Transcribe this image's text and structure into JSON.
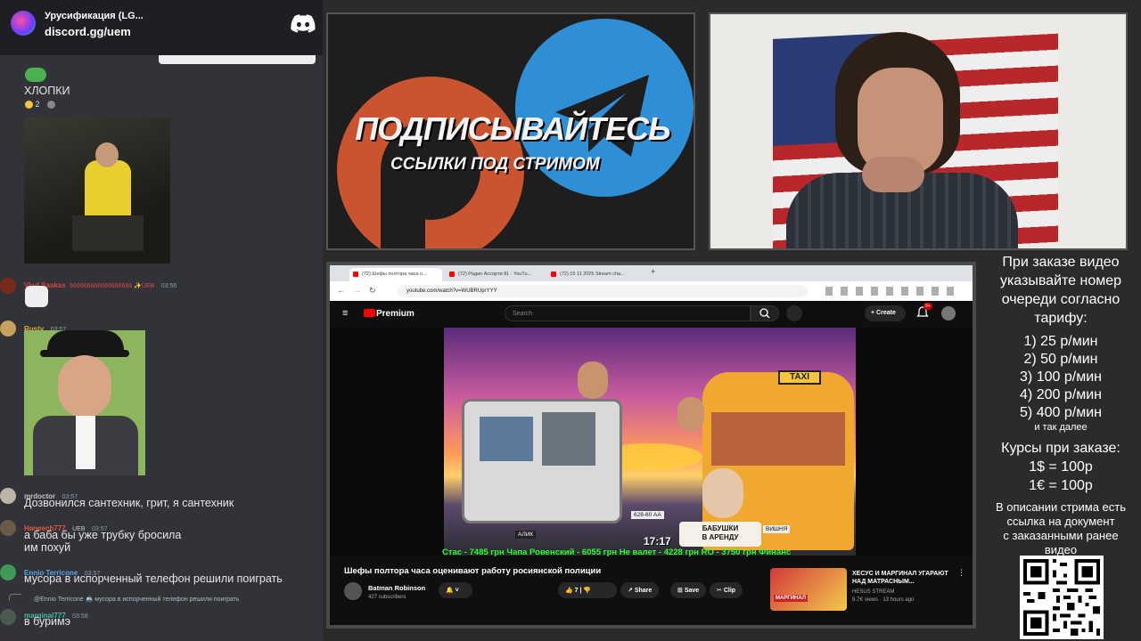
{
  "discord": {
    "server_name": "Урусификация (LG...",
    "invite": "discord.gg/uem"
  },
  "chat": {
    "msg_top": {
      "text": "ХЛОПКИ",
      "reaction_count": "2"
    },
    "msg_vlad": {
      "name": "Vlad Saakas",
      "text": "666666666666666666 ✨UEB",
      "time": "03:56"
    },
    "msg_rusty": {
      "name": "Rusty",
      "time": "03:57"
    },
    "msg_mrdoctor": {
      "name": "mrdoctor",
      "time": "03:57",
      "text": "Дозвонился сантехник, грит, я сантехник"
    },
    "msg_haneech": {
      "name": "Haneech777",
      "tag": "UEB",
      "time": "03:57",
      "text1": "а баба бы уже трубку бросила",
      "text2": "им похуй"
    },
    "msg_ennio": {
      "name": "Ennio Terricone",
      "time": "03:57",
      "text": "мусора в испорченный телефон решили поиграть"
    },
    "reply_preview": "@Ennio Terricone 🚢 мусора в испорченный телефон решили поиграть",
    "msg_marginal": {
      "name": "marginal777",
      "time": "03:58",
      "text": "в буримэ"
    }
  },
  "promo": {
    "title": "ПОДПИСЫВАЙТЕСЬ",
    "subtitle": "ССЫЛКИ ПОД СТРИМОМ"
  },
  "browser": {
    "tabs": [
      "(72) Шефы полтора часа о...",
      "(72) Радио Ассорти 81 · YouTu...",
      "(72) 15 11 2025 Stream cha..."
    ],
    "url": "youtube.com/watch?v=WUBRUprYYY"
  },
  "youtube": {
    "brand": "Premium",
    "search_placeholder": "Search",
    "create_label": "Create",
    "notif_badge": "9+",
    "ticker": "Стас - 7485 грн     Чапа Ровенский - 6055 грн     Не валет - 4228 грн     RO - 3750 грн     Финанс",
    "clock": "17:17",
    "sign": "БАБУШКИ\nВ АРЕНДУ",
    "thumb_taxi": "TAXI",
    "thumb_alik": "АЛИК",
    "thumb_plate": "628-60 АА",
    "thumb_vishnya": "ВИШНЯ",
    "video_title": "Шефы полтора часа оценивают работу росиянской полиции",
    "channel": "Batman Robinson",
    "subs": "427 subscribers",
    "likes": "7",
    "share": "Share",
    "save": "Save",
    "clip": "Clip",
    "rec_title": "ХЕСУС И МАРГИНАЛ УГАРАЮТ НАД МАТРАСНЫМ...",
    "rec_channel": "HESUS STREAM",
    "rec_meta": "9.7K views · 13 hours ago",
    "rec_thumb_text": "МАРГИНАЛ"
  },
  "pricing": {
    "intro": [
      "При заказе видео",
      "указывайте номер",
      "очереди согласно",
      "тарифу:"
    ],
    "rates": [
      "1) 25 р/мин",
      "2) 50 р/мин",
      "3) 100 р/мин",
      "4) 200 р/мин",
      "5) 400 р/мин"
    ],
    "etc": "и так далее",
    "rates_header": "Курсы при заказе:",
    "rate_usd": "1$ = 100р",
    "rate_eur": "1€ = 100р",
    "desc": [
      "В описании стрима есть",
      "ссылка на документ",
      "с заказанными ранее",
      "видео"
    ]
  },
  "colors": {
    "discord_bg": "#313338",
    "discord_dark": "#1e1f22",
    "yt_red": "#ff0000",
    "ticker_green": "#2aff2a"
  }
}
